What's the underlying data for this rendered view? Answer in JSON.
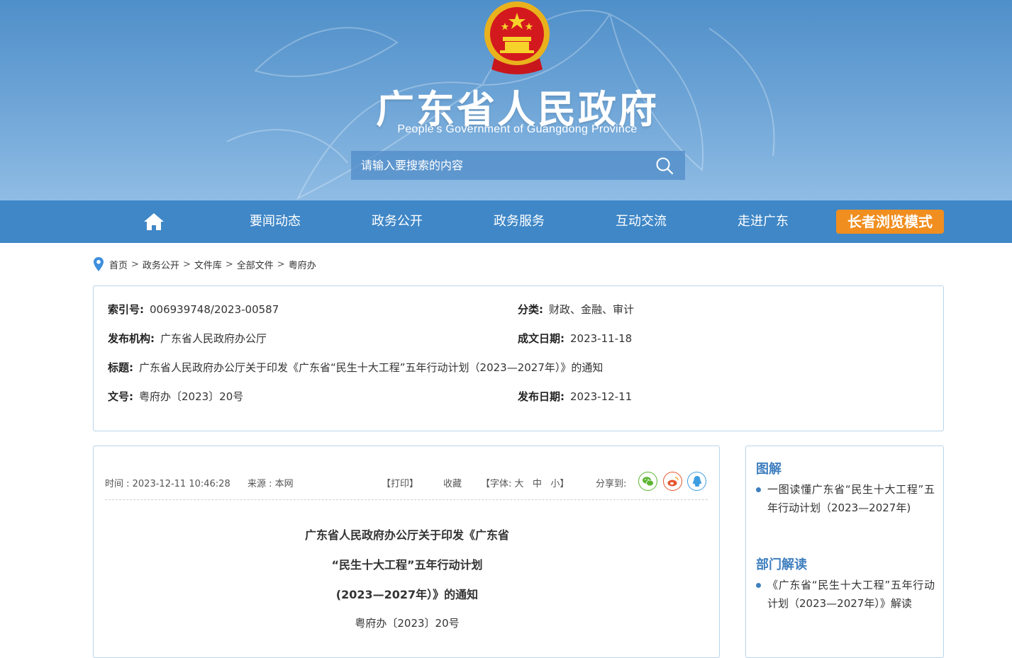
{
  "header": {
    "title": "广东省人民政府",
    "subtitle": "People's Government of Guangdong Province",
    "search_placeholder": "请输入要搜索的内容"
  },
  "nav": {
    "items": [
      "要闻动态",
      "政务公开",
      "政务服务",
      "互动交流",
      "走进广东"
    ],
    "elder_mode": "长者浏览模式"
  },
  "breadcrumb": [
    "首页",
    "政务公开",
    "文件库",
    "全部文件",
    "粤府办"
  ],
  "info": {
    "index_label": "索引号:",
    "index_value": "006939748/2023-00587",
    "category_label": "分类:",
    "category_value": "财政、金融、审计",
    "publisher_label": "发布机构:",
    "publisher_value": "广东省人民政府办公厅",
    "written_date_label": "成文日期:",
    "written_date_value": "2023-11-18",
    "title_label": "标题:",
    "title_value": "广东省人民政府办公厅关于印发《广东省“民生十大工程”五年行动计划（2023—2027年）》的通知",
    "doc_no_label": "文号:",
    "doc_no_value": "粤府办〔2023〕20号",
    "publish_date_label": "发布日期:",
    "publish_date_value": "2023-12-11"
  },
  "article": {
    "time": "时间 : 2023-12-11 10:46:28",
    "source": "来源 : 本网",
    "print": "【打印】",
    "favorite": "收藏",
    "font_prefix": "【字体: ",
    "font_large": "大",
    "font_medium": "中",
    "font_small": "小",
    "font_suffix": "】",
    "share_label": "分享到:",
    "title_line1": "广东省人民政府办公厅关于印发《广东省",
    "title_line2": "“民生十大工程”五年行动计划",
    "title_line3": "(2023—2027年）》的通知",
    "doc_no": "粤府办〔2023〕20号"
  },
  "sidebar": {
    "section1_title": "图解",
    "section1_item": "一图读懂广东省“民生十大工程”五年行动计划（2023—2027年)",
    "section2_title": "部门解读",
    "section2_item": "《广东省“民生十大工程”五年行动计划（2023—2027年）》解读"
  },
  "colors": {
    "nav_bg": "#3f87c7",
    "elder_button": "#f08e1f",
    "accent_blue": "#3f7fbf",
    "wechat": "#5cb531",
    "weibo": "#e6542d",
    "qq": "#3d9de0"
  },
  "icons": [
    "emblem-icon",
    "search-icon",
    "home-icon",
    "location-pin-icon",
    "wechat-icon",
    "weibo-icon",
    "qq-icon"
  ]
}
